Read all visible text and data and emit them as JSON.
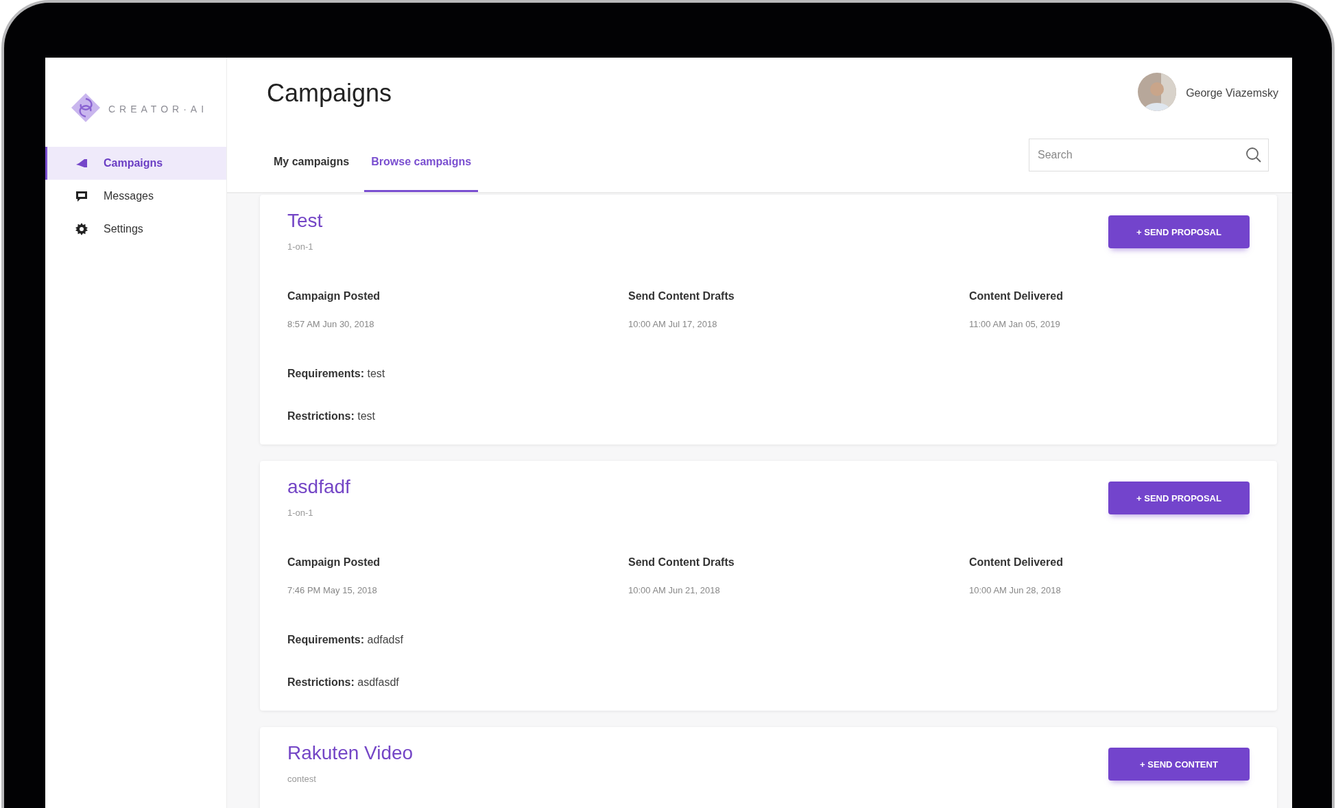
{
  "brand": {
    "name": "CREATOR·AI"
  },
  "sidebar": {
    "items": [
      {
        "label": "Campaigns",
        "selected": true
      },
      {
        "label": "Messages",
        "selected": false
      },
      {
        "label": "Settings",
        "selected": false
      }
    ]
  },
  "header": {
    "title": "Campaigns",
    "user": {
      "name": "George Viazemsky"
    }
  },
  "tabs": [
    {
      "label": "My campaigns",
      "selected": false
    },
    {
      "label": "Browse campaigns",
      "selected": true
    }
  ],
  "search": {
    "placeholder": "Search"
  },
  "campaigns": [
    {
      "title": "Test",
      "type": "1-on-1",
      "button": "+ SEND PROPOSAL",
      "milestones": [
        {
          "label": "Campaign Posted",
          "value": "8:57 AM Jun 30, 2018"
        },
        {
          "label": "Send Content Drafts",
          "value": "10:00 AM Jul 17, 2018"
        },
        {
          "label": "Content Delivered",
          "value": "11:00 AM Jan 05, 2019"
        }
      ],
      "details": [
        "**Requirements:** test",
        "**Restrictions:** test"
      ]
    },
    {
      "title": "asdfadf",
      "type": "1-on-1",
      "button": "+ SEND PROPOSAL",
      "milestones": [
        {
          "label": "Campaign Posted",
          "value": "7:46 PM May 15, 2018"
        },
        {
          "label": "Send Content Drafts",
          "value": "10:00 AM Jun 21, 2018"
        },
        {
          "label": "Content Delivered",
          "value": "10:00 AM Jun 28, 2018"
        }
      ],
      "details": [
        "**Requirements:** adfadsf",
        "**Restrictions:** asdfasdf"
      ]
    },
    {
      "title": "Rakuten Video",
      "type": "contest",
      "button": "+ SEND CONTENT"
    }
  ]
}
